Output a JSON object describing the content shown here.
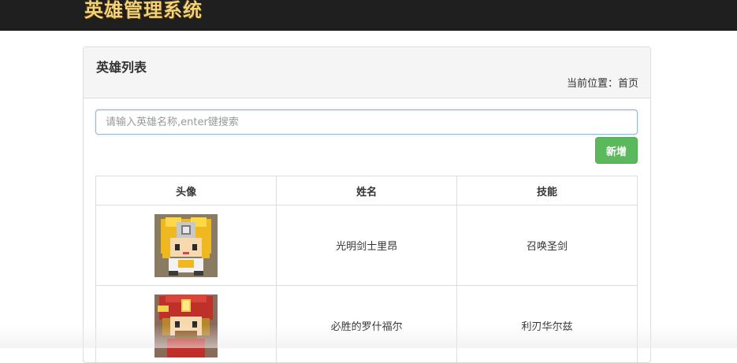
{
  "app": {
    "title": "英雄管理系统"
  },
  "panel": {
    "title": "英雄列表",
    "breadcrumb": "当前位置：首页"
  },
  "search": {
    "placeholder": "请输入英雄名称,enter键搜索",
    "value": ""
  },
  "toolbar": {
    "add_label": "新增"
  },
  "table": {
    "headers": [
      "头像",
      "姓名",
      "技能"
    ],
    "rows": [
      {
        "avatar": "hero-1-avatar",
        "name": "光明剑士里昂",
        "skill": "召唤圣剑"
      },
      {
        "avatar": "hero-2-avatar",
        "name": "必胜的罗什福尔",
        "skill": "利刃华尔兹"
      }
    ]
  },
  "colors": {
    "topbar": "#1f1f1f",
    "brand_text": "#f2d27a",
    "add_button": "#5cb85c",
    "panel_heading": "#f5f5f5",
    "border": "#dddddd"
  }
}
